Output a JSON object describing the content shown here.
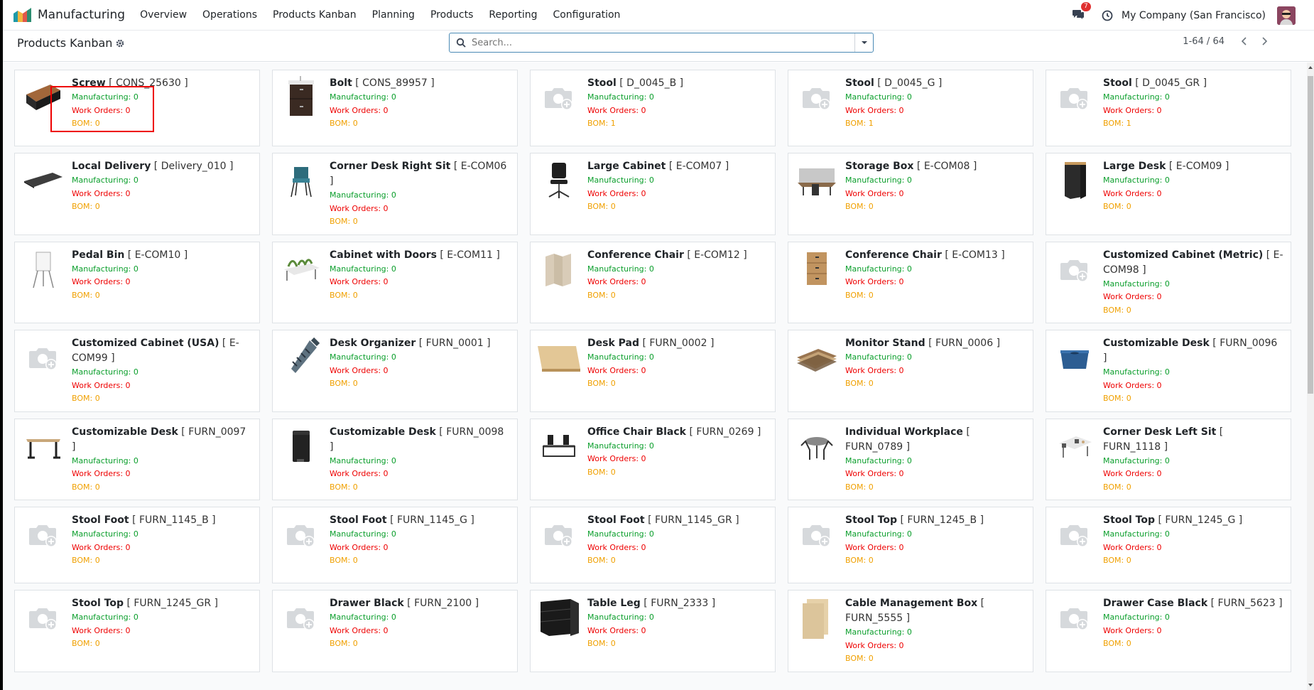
{
  "app": {
    "name": "Manufacturing",
    "menu": [
      "Overview",
      "Operations",
      "Products Kanban",
      "Planning",
      "Products",
      "Reporting",
      "Configuration"
    ],
    "chat_count": "7",
    "company": "My Company (San Francisco)"
  },
  "control_panel": {
    "title": "Products Kanban",
    "search_placeholder": "Search...",
    "pager": "1-64 / 64"
  },
  "labels": {
    "mfg": "Manufacturing: ",
    "wo": "Work Orders: ",
    "bom": "BOM: "
  },
  "products": [
    {
      "name": "Screw",
      "ref": "[ CONS_25630 ]",
      "mfg": "0",
      "wo": "0",
      "bom": "0",
      "img": "storage-box"
    },
    {
      "name": "Bolt",
      "ref": "[ CONS_89957 ]",
      "mfg": "0",
      "wo": "0",
      "bom": "0",
      "img": "drawer-cabinet"
    },
    {
      "name": "Stool",
      "ref": "[ D_0045_B ]",
      "mfg": "0",
      "wo": "0",
      "bom": "1",
      "img": "placeholder"
    },
    {
      "name": "Stool",
      "ref": "[ D_0045_G ]",
      "mfg": "0",
      "wo": "0",
      "bom": "1",
      "img": "placeholder"
    },
    {
      "name": "Stool",
      "ref": "[ D_0045_GR ]",
      "mfg": "0",
      "wo": "0",
      "bom": "1",
      "img": "placeholder"
    },
    {
      "name": "Local Delivery",
      "ref": "[ Delivery_010 ]",
      "mfg": "0",
      "wo": "0",
      "bom": "0",
      "img": "desk-pad"
    },
    {
      "name": "Corner Desk Right Sit",
      "ref": "[ E-COM06 ]",
      "mfg": "0",
      "wo": "0",
      "bom": "0",
      "img": "chair-blue"
    },
    {
      "name": "Large Cabinet",
      "ref": "[ E-COM07 ]",
      "mfg": "0",
      "wo": "0",
      "bom": "0",
      "img": "office-chair"
    },
    {
      "name": "Storage Box",
      "ref": "[ E-COM08 ]",
      "mfg": "0",
      "wo": "0",
      "bom": "0",
      "img": "desk-set"
    },
    {
      "name": "Large Desk",
      "ref": "[ E-COM09 ]",
      "mfg": "0",
      "wo": "0",
      "bom": "0",
      "img": "black-cabinet"
    },
    {
      "name": "Pedal Bin",
      "ref": "[ E-COM10 ]",
      "mfg": "0",
      "wo": "0",
      "bom": "0",
      "img": "flipchart"
    },
    {
      "name": "Cabinet with Doors",
      "ref": "[ E-COM11 ]",
      "mfg": "0",
      "wo": "0",
      "bom": "0",
      "img": "planter-desk"
    },
    {
      "name": "Conference Chair",
      "ref": "[ E-COM12 ]",
      "mfg": "0",
      "wo": "0",
      "bom": "0",
      "img": "room-divider"
    },
    {
      "name": "Conference Chair",
      "ref": "[ E-COM13 ]",
      "mfg": "0",
      "wo": "0",
      "bom": "0",
      "img": "wood-drawers"
    },
    {
      "name": "Customized Cabinet (Metric)",
      "ref": "[ E-COM98 ]",
      "mfg": "0",
      "wo": "0",
      "bom": "0",
      "img": "placeholder"
    },
    {
      "name": "Customized Cabinet (USA)",
      "ref": "[ E-COM99 ]",
      "mfg": "0",
      "wo": "0",
      "bom": "0",
      "img": "placeholder"
    },
    {
      "name": "Desk Organizer",
      "ref": "[ FURN_0001 ]",
      "mfg": "0",
      "wo": "0",
      "bom": "0",
      "img": "screw"
    },
    {
      "name": "Desk Pad",
      "ref": "[ FURN_0002 ]",
      "mfg": "0",
      "wo": "0",
      "bom": "0",
      "img": "plywood"
    },
    {
      "name": "Monitor Stand",
      "ref": "[ FURN_0006 ]",
      "mfg": "0",
      "wo": "0",
      "bom": "0",
      "img": "wood-panels"
    },
    {
      "name": "Customizable Desk",
      "ref": "[ FURN_0096 ]",
      "mfg": "0",
      "wo": "0",
      "bom": "0",
      "img": "blue-box"
    },
    {
      "name": "Customizable Desk",
      "ref": "[ FURN_0097 ]",
      "mfg": "0",
      "wo": "0",
      "bom": "0",
      "img": "desk-frame"
    },
    {
      "name": "Customizable Desk",
      "ref": "[ FURN_0098 ]",
      "mfg": "0",
      "wo": "0",
      "bom": "0",
      "img": "pedal-bin"
    },
    {
      "name": "Office Chair Black",
      "ref": "[ FURN_0269 ]",
      "mfg": "0",
      "wo": "0",
      "bom": "0",
      "img": "desk-screens"
    },
    {
      "name": "Individual Workplace",
      "ref": "[ FURN_0789 ]",
      "mfg": "0",
      "wo": "0",
      "bom": "0",
      "img": "round-table"
    },
    {
      "name": "Corner Desk Left Sit",
      "ref": "[ FURN_1118 ]",
      "mfg": "0",
      "wo": "0",
      "bom": "0",
      "img": "meeting-desks"
    },
    {
      "name": "Stool Foot",
      "ref": "[ FURN_1145_B ]",
      "mfg": "0",
      "wo": "0",
      "bom": "0",
      "img": "placeholder"
    },
    {
      "name": "Stool Foot",
      "ref": "[ FURN_1145_G ]",
      "mfg": "0",
      "wo": "0",
      "bom": "0",
      "img": "placeholder"
    },
    {
      "name": "Stool Foot",
      "ref": "[ FURN_1145_GR ]",
      "mfg": "0",
      "wo": "0",
      "bom": "0",
      "img": "placeholder"
    },
    {
      "name": "Stool Top",
      "ref": "[ FURN_1245_B ]",
      "mfg": "0",
      "wo": "0",
      "bom": "0",
      "img": "placeholder"
    },
    {
      "name": "Stool Top",
      "ref": "[ FURN_1245_G ]",
      "mfg": "0",
      "wo": "0",
      "bom": "0",
      "img": "placeholder"
    },
    {
      "name": "Stool Top",
      "ref": "[ FURN_1245_GR ]",
      "mfg": "0",
      "wo": "0",
      "bom": "0",
      "img": "placeholder"
    },
    {
      "name": "Drawer Black",
      "ref": "[ FURN_2100 ]",
      "mfg": "0",
      "wo": "0",
      "bom": "0",
      "img": "placeholder"
    },
    {
      "name": "Table Leg",
      "ref": "[ FURN_2333 ]",
      "mfg": "0",
      "wo": "0",
      "bom": "0",
      "img": "black-drawers"
    },
    {
      "name": "Cable Management Box",
      "ref": "[ FURN_5555 ]",
      "mfg": "0",
      "wo": "0",
      "bom": "0",
      "img": "wood-boards"
    },
    {
      "name": "Drawer Case Black",
      "ref": "[ FURN_5623 ]",
      "mfg": "0",
      "wo": "0",
      "bom": "0",
      "img": "placeholder"
    }
  ]
}
